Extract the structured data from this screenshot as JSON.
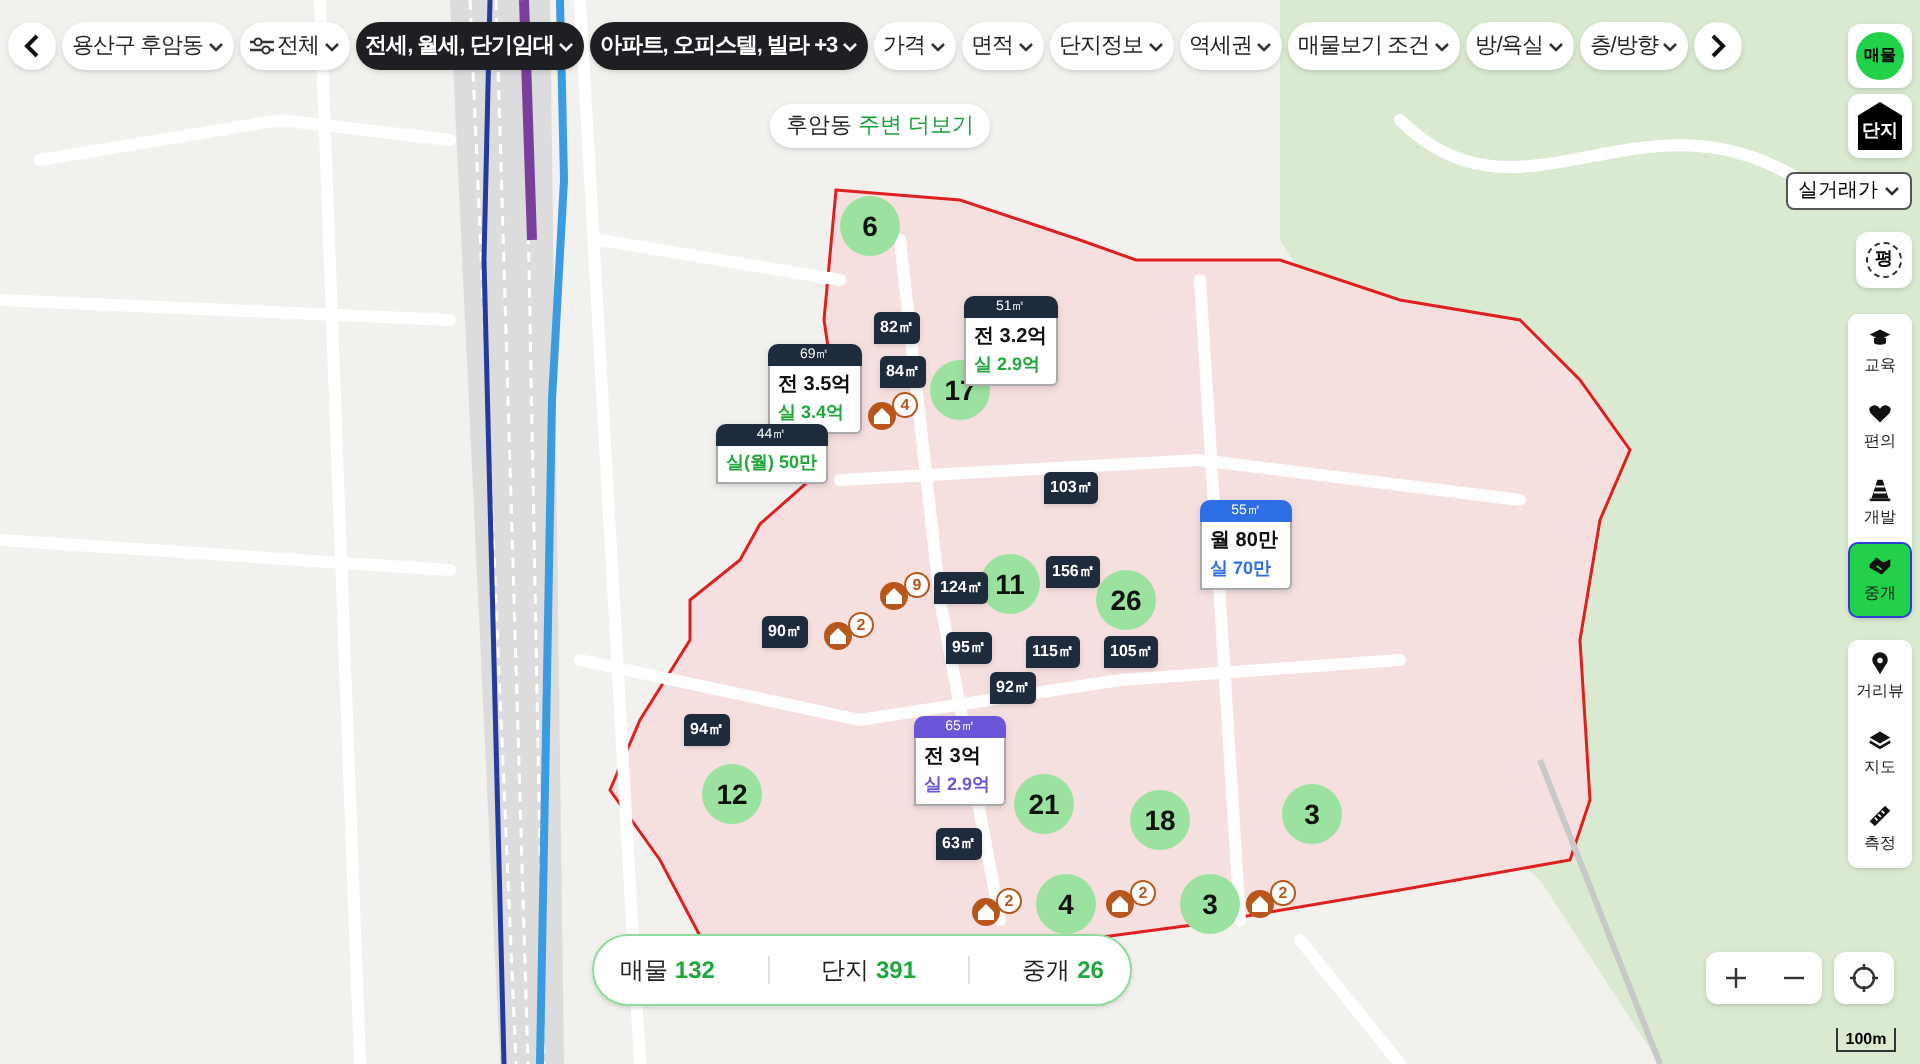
{
  "filters": [
    {
      "label": "용산구 후암동",
      "kind": "dropdown",
      "selected": false
    },
    {
      "label": "전체",
      "kind": "filter",
      "selected": false
    },
    {
      "label": "전세, 월세, 단기임대",
      "kind": "dropdown",
      "selected": true
    },
    {
      "label": "아파트, 오피스텔, 빌라 +3",
      "kind": "dropdown",
      "selected": true
    },
    {
      "label": "가격",
      "kind": "dropdown",
      "selected": false
    },
    {
      "label": "면적",
      "kind": "dropdown",
      "selected": false
    },
    {
      "label": "단지정보",
      "kind": "dropdown",
      "selected": false
    },
    {
      "label": "역세권",
      "kind": "dropdown",
      "selected": false
    },
    {
      "label": "매물보기 조건",
      "kind": "dropdown",
      "selected": false
    },
    {
      "label": "방/욕실",
      "kind": "dropdown",
      "selected": false
    },
    {
      "label": "층/방향",
      "kind": "dropdown",
      "selected": false
    }
  ],
  "nearby": {
    "place": "후암동",
    "action": "주변 더보기"
  },
  "layers": [
    {
      "label": "매물",
      "kind": "circle",
      "selected": true
    },
    {
      "label": "단지",
      "kind": "house",
      "selected": false
    }
  ],
  "price_mode": {
    "label": "실거래가"
  },
  "unit_toggle": {
    "label": "평"
  },
  "tools": [
    {
      "label": "교육",
      "kind": "education",
      "selected": false
    },
    {
      "label": "편의",
      "kind": "convenience",
      "selected": false
    },
    {
      "label": "개발",
      "kind": "development",
      "selected": false
    },
    {
      "label": "중개",
      "kind": "broker",
      "selected": true
    }
  ],
  "map_tools": [
    {
      "label": "거리뷰",
      "kind": "streetview"
    },
    {
      "label": "지도",
      "kind": "layers"
    },
    {
      "label": "측정",
      "kind": "ruler"
    }
  ],
  "clusters": [
    {
      "count": "6"
    },
    {
      "count": "17"
    },
    {
      "count": "11"
    },
    {
      "count": "26"
    },
    {
      "count": "12"
    },
    {
      "count": "21"
    },
    {
      "count": "18"
    },
    {
      "count": "3"
    },
    {
      "count": "4"
    },
    {
      "count": "3"
    }
  ],
  "area_tags": [
    {
      "area": "82㎡"
    },
    {
      "area": "84㎡"
    },
    {
      "area": "103㎡"
    },
    {
      "area": "124㎡"
    },
    {
      "area": "156㎡"
    },
    {
      "area": "90㎡"
    },
    {
      "area": "95㎡"
    },
    {
      "area": "115㎡"
    },
    {
      "area": "92㎡"
    },
    {
      "area": "105㎡"
    },
    {
      "area": "94㎡"
    },
    {
      "area": "63㎡"
    }
  ],
  "broker_badges": [
    {
      "count": "4"
    },
    {
      "count": "2"
    },
    {
      "count": "9"
    },
    {
      "count": "2"
    },
    {
      "count": "2"
    },
    {
      "count": "2"
    }
  ],
  "listing_markers": [
    {
      "area": "69㎡",
      "color": "#1e2b3c",
      "lines": [
        {
          "text": "전 3.5억",
          "kind": "offer"
        },
        {
          "text": "실 3.4억",
          "kind": "actual",
          "color": "#1fa83a"
        }
      ]
    },
    {
      "area": "44㎡",
      "color": "#1e2b3c",
      "lines": [
        {
          "text": "실(월) 50만",
          "kind": "actual",
          "color": "#1fa83a"
        }
      ]
    },
    {
      "area": "51㎡",
      "color": "#1e2b3c",
      "lines": [
        {
          "text": "전 3.2억",
          "kind": "offer"
        },
        {
          "text": "실 2.9억",
          "kind": "actual",
          "color": "#1fa83a"
        }
      ]
    },
    {
      "area": "55㎡",
      "color": "#2f6fe6",
      "lines": [
        {
          "text": "월 80만",
          "kind": "offer"
        },
        {
          "text": "실 70만",
          "kind": "actual",
          "color": "#2f6fe6"
        }
      ]
    },
    {
      "area": "65㎡",
      "color": "#6b55d8",
      "lines": [
        {
          "text": "전 3억",
          "kind": "offer"
        },
        {
          "text": "실 2.9억",
          "kind": "actual",
          "color": "#6b55d8"
        }
      ]
    }
  ],
  "summary": [
    {
      "label": "매물",
      "value": "132"
    },
    {
      "label": "단지",
      "value": "391"
    },
    {
      "label": "중개",
      "value": "26"
    }
  ],
  "scale": {
    "label": "100m"
  }
}
